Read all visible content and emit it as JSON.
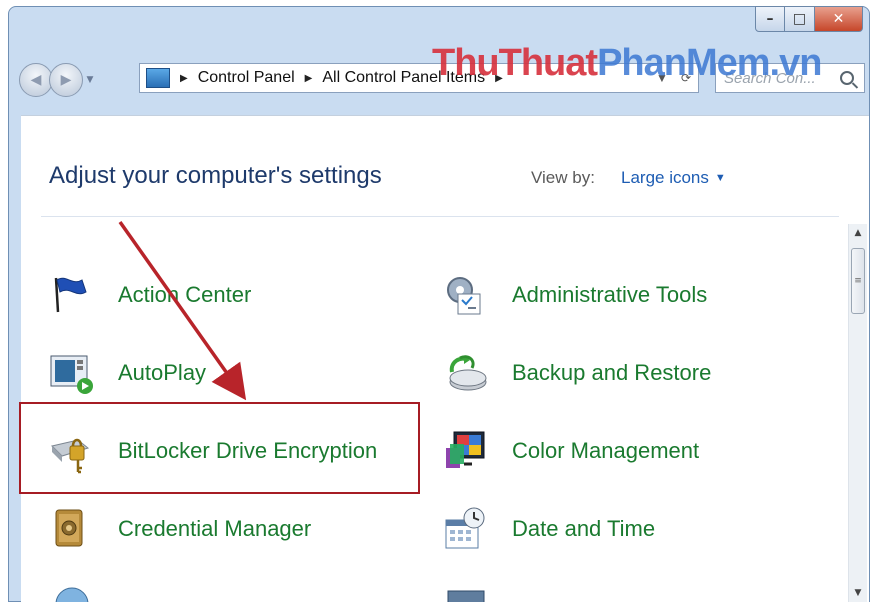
{
  "window": {
    "buttons": {
      "minimize": "–",
      "maximize": "□",
      "close": "✕"
    }
  },
  "address": {
    "crumbs": [
      "Control Panel",
      "All Control Panel Items"
    ],
    "search_placeholder": "Search Con..."
  },
  "watermark": {
    "part1": "ThuThuat",
    "part2": "PhanMem",
    "part3": ".vn"
  },
  "main": {
    "title": "Adjust your computer's settings",
    "view_by_label": "View by:",
    "view_by_value": "Large icons"
  },
  "items": [
    {
      "label": "Action Center",
      "icon": "flag-icon"
    },
    {
      "label": "Administrative Tools",
      "icon": "admin-tools-icon"
    },
    {
      "label": "AutoPlay",
      "icon": "autoplay-icon"
    },
    {
      "label": "Backup and Restore",
      "icon": "backup-icon"
    },
    {
      "label": "BitLocker Drive Encryption",
      "icon": "bitlocker-icon"
    },
    {
      "label": "Color Management",
      "icon": "color-management-icon"
    },
    {
      "label": "Credential Manager",
      "icon": "credential-manager-icon"
    },
    {
      "label": "Date and Time",
      "icon": "date-time-icon"
    }
  ],
  "colors": {
    "link_green": "#1a7a2f",
    "title_blue": "#1e3a6b",
    "highlight_red": "#a61c24"
  }
}
